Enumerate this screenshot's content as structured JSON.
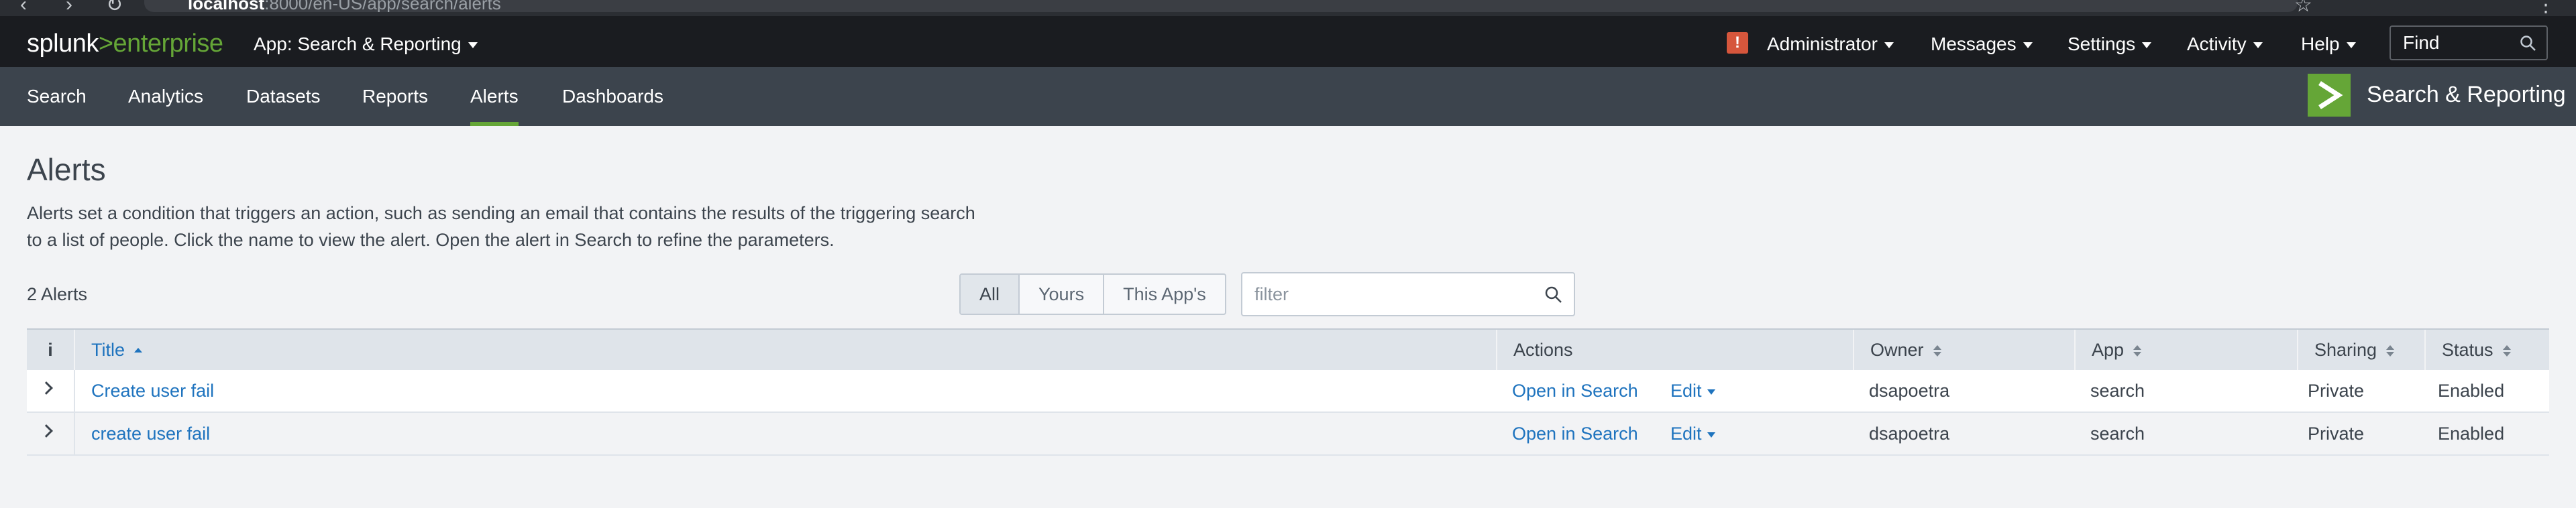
{
  "browser": {
    "url_host": "localhost",
    "url_path": ":8000/en-US/app/search/alerts"
  },
  "topbar": {
    "logo_brand": "splunk",
    "logo_sep": ">",
    "logo_product": "enterprise",
    "app_menu_label": "App: Search & Reporting",
    "alert_badge": "!",
    "menus": [
      "Administrator",
      "Messages",
      "Settings",
      "Activity",
      "Help"
    ],
    "find_placeholder": "Find"
  },
  "appbar": {
    "nav": [
      "Search",
      "Analytics",
      "Datasets",
      "Reports",
      "Alerts",
      "Dashboards"
    ],
    "active": "Alerts",
    "app_title": "Search & Reporting",
    "accent_color": "#65a637"
  },
  "main": {
    "title": "Alerts",
    "description": "Alerts set a condition that triggers an action, such as sending an email that contains the results of the triggering search to a list of people. Click the name to view the alert. Open the alert in Search to refine the parameters.",
    "count_label": "2 Alerts",
    "filter_tabs": [
      "All",
      "Yours",
      "This App's"
    ],
    "filter_selected": "All",
    "filter_placeholder": "filter"
  },
  "table": {
    "info_header": "i",
    "columns": [
      "Title",
      "Actions",
      "Owner",
      "App",
      "Sharing",
      "Status"
    ],
    "rows": [
      {
        "title": "Create user fail",
        "action_open": "Open in Search",
        "action_edit": "Edit",
        "owner": "dsapoetra",
        "app": "search",
        "sharing": "Private",
        "status": "Enabled"
      },
      {
        "title": "create user fail",
        "action_open": "Open in Search",
        "action_edit": "Edit",
        "owner": "dsapoetra",
        "app": "search",
        "sharing": "Private",
        "status": "Enabled"
      }
    ]
  }
}
